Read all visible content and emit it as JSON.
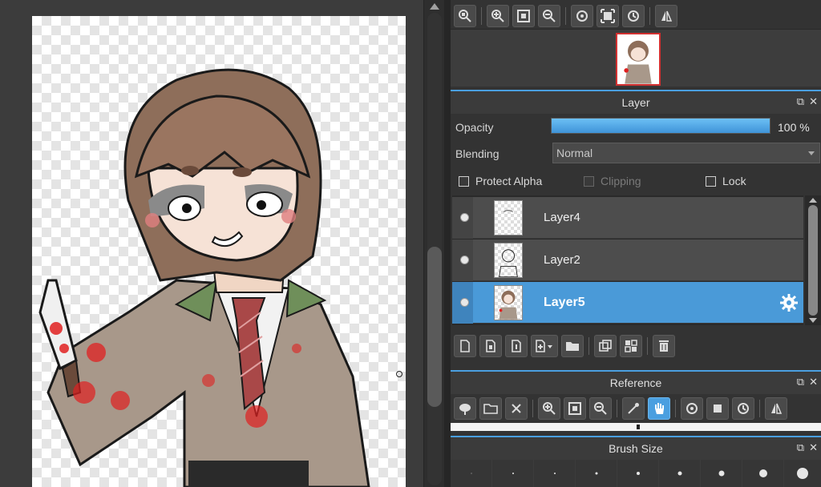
{
  "top_toolbar": {
    "icons": [
      "zoom-actual-icon",
      "zoom-in-icon",
      "fit-screen-icon",
      "zoom-out-icon",
      "rotate-left-icon",
      "reset-view-icon",
      "rotate-right-icon",
      "flip-horizontal-icon"
    ]
  },
  "layer_panel": {
    "title": "Layer",
    "opacity_label": "Opacity",
    "opacity_value": "100 %",
    "opacity_fraction": 1.0,
    "blending_label": "Blending",
    "blending_value": "Normal",
    "protect_alpha_label": "Protect Alpha",
    "clipping_label": "Clipping",
    "lock_label": "Lock",
    "layers": [
      {
        "name": "Layer4",
        "selected": false
      },
      {
        "name": "Layer2",
        "selected": false
      },
      {
        "name": "Layer5",
        "selected": true
      }
    ],
    "tools": [
      "new-layer-icon",
      "new-halftone-layer-icon",
      "new-8bit-layer-icon",
      "add-layer-menu-icon",
      "new-folder-icon",
      "duplicate-layer-icon",
      "merge-layer-icon",
      "delete-layer-icon"
    ]
  },
  "reference_panel": {
    "title": "Reference",
    "tools": [
      "load-cloud-icon",
      "open-folder-icon",
      "close-icon",
      "zoom-in-icon",
      "fit-screen-icon",
      "zoom-out-icon",
      "eyedropper-icon",
      "hand-icon",
      "rotate-left-icon",
      "reset-view-icon",
      "rotate-right-icon",
      "flip-horizontal-icon"
    ]
  },
  "brush_size_panel": {
    "title": "Brush Size"
  },
  "colors": {
    "accent": "#4a9fe0",
    "panel_bg": "#333333",
    "selected_layer": "#4a9ad8"
  }
}
